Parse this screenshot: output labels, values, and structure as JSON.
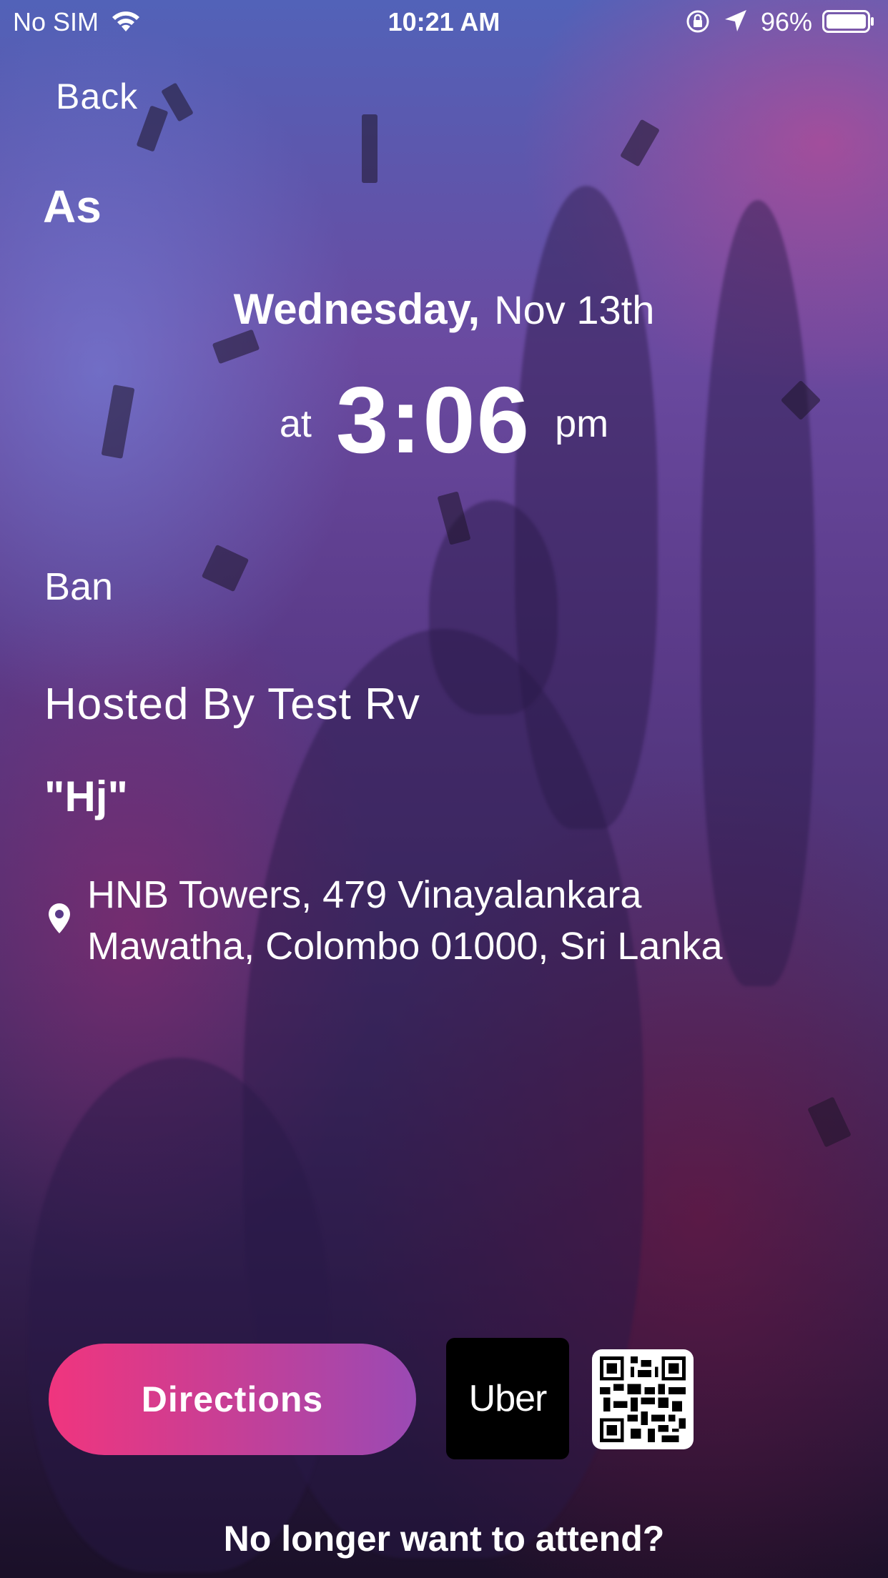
{
  "status_bar": {
    "carrier": "No SIM",
    "time": "10:21 AM",
    "battery_percent": "96%"
  },
  "nav": {
    "back_label": "Back"
  },
  "event": {
    "title": "As",
    "weekday": "Wednesday,",
    "date": "Nov 13th",
    "time_prefix": "at",
    "time": "3:06",
    "time_suffix": "pm",
    "description": "Ban",
    "host": "Hosted By Test Rv",
    "quote": "\"Hj\"",
    "address_line1": "HNB Towers, 479 Vinayalankara",
    "address_line2": "Mawatha, Colombo 01000, Sri Lanka"
  },
  "actions": {
    "directions_label": "Directions",
    "uber_label": "Uber",
    "qr_icon": "qr-code-icon",
    "cancel_label": "No longer want to attend?"
  },
  "colors": {
    "directions_gradient_start": "#f0357e",
    "directions_gradient_end": "#9a4ab4",
    "uber_bg": "#000000",
    "text": "#ffffff"
  }
}
